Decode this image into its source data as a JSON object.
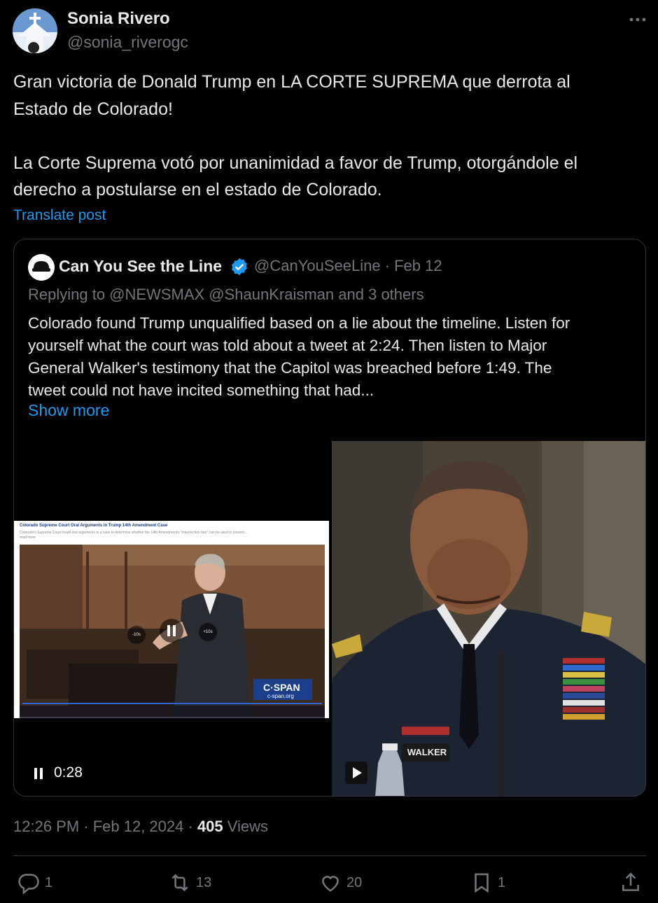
{
  "author": {
    "name": "Sonia Rivero",
    "handle": "@sonia_riverogc"
  },
  "post": {
    "lines": [
      "Gran victoria de Donald Trump en LA CORTE SUPREMA que derrota al",
      "Estado de Colorado!",
      "La Corte Suprema votó por unanimidad a favor de Trump, otorgándole el",
      "derecho a postularse en el estado de Colorado."
    ],
    "translate_label": "Translate post"
  },
  "quote": {
    "name": "Can You See the Line",
    "handle_date": "@CanYouSeeLine · Feb 12",
    "replying": "Replying to @NEWSMAX @ShaunKraisman and 3 others",
    "lines": [
      "Colorado found Trump unqualified based on a lie about the timeline. Listen for",
      "yourself what the court was told about a tweet at 2:24. Then listen to Major",
      "General Walker's testimony that the Capitol was breached before 1:49. The",
      "tweet could not have incited something that had..."
    ],
    "show_more": "Show more",
    "video": {
      "time": "0:28",
      "headline": "Colorado Supreme Court Oral Arguments in Trump 14th Amendment Case",
      "subline": "Colorado's Supreme Court heard oral arguments in a case to determine whether the 14th Amendment's \"insurrection ban\" can be used to prevent... read more",
      "skip_back": "-10s",
      "skip_fwd": "+10s",
      "network": "C·SPAN",
      "network_url": "c-span.org",
      "nameplate": "WALKER"
    }
  },
  "meta": {
    "time_date": "12:26 PM · Feb 12, 2024 · ",
    "views_count": "405",
    "views_label": " Views"
  },
  "actions": {
    "replies": "1",
    "reposts": "13",
    "likes": "20",
    "bookmarks": "1"
  },
  "colors": {
    "accent": "#1d9bf0",
    "secondary_text": "#71767b",
    "border": "#2f3336"
  }
}
